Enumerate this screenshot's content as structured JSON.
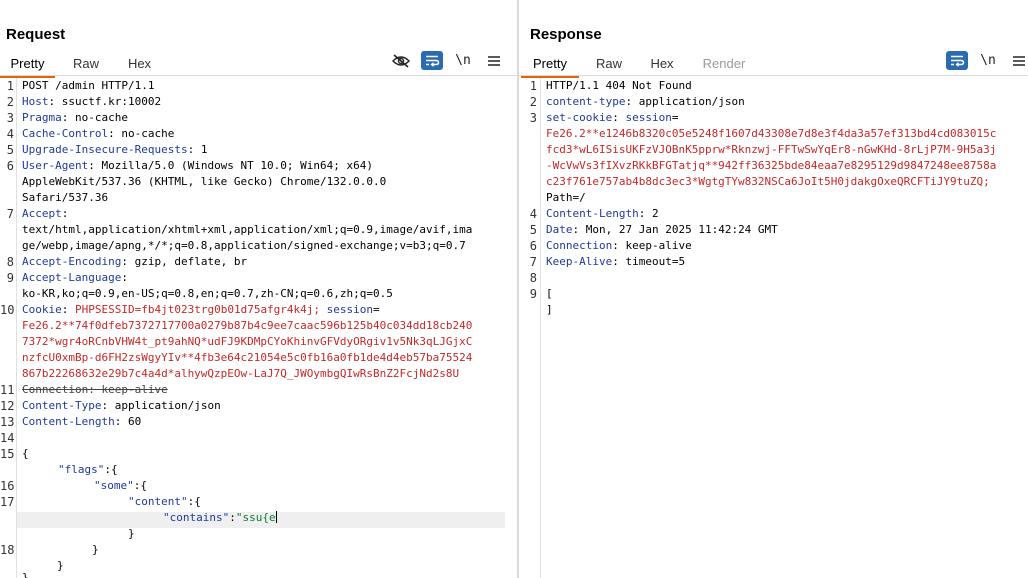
{
  "request": {
    "title": "Request",
    "tabs": [
      "Pretty",
      "Raw",
      "Hex"
    ],
    "newline_toggle": "\\n",
    "lines": {
      "l1": "POST /admin HTTP/1.1",
      "l2k": "Host",
      "l2v": ": ssuctf.kr:10002",
      "l3k": "Pragma",
      "l3v": ": no-cache",
      "l4k": "Cache-Control",
      "l4v": ": no-cache",
      "l5k": "Upgrade-Insecure-Requests",
      "l5v": ": 1",
      "l6k": "User-Agent",
      "l6v": ": Mozilla/5.0 (Windows NT 10.0; Win64; x64)",
      "l6c1": "AppleWebKit/537.36 (KHTML, like Gecko) Chrome/132.0.0.0",
      "l6c2": "Safari/537.36",
      "l7k": "Accept",
      "l7v": ":",
      "l7c1": "text/html,application/xhtml+xml,application/xml;q=0.9,image/avif,ima",
      "l7c2": "ge/webp,image/apng,*/*;q=0.8,application/signed-exchange;v=b3;q=0.7",
      "l8k": "Accept-Encoding",
      "l8v": ": gzip, deflate, br",
      "l9k": "Accept-Language",
      "l9v": ":",
      "l9c1": "ko-KR,ko;q=0.9,en-US;q=0.8,en;q=0.7,zh-CN;q=0.6,zh;q=0.5",
      "l10k": "Cookie",
      "l10colon": ":",
      "l10a": "PHPSESSID",
      "l10b": "=fb4jt023trg0b01d75afgr4k4j;",
      "l10c": "session",
      "l10d": "=",
      "l10c1": "Fe26.2**74f0dfeb7372717700a0279b87b4c9ee7caac596b125b40c034dd18cb240",
      "l10c2": "7372*wgr4oRCnbVHW4t_pt9ahNQ*udFJ9KDMpCYoKhinvGFVdyORgiv1v5Nk3qLJGjxC",
      "l10c3": "nzfcU0xmBp-d6FH2zsWgyYIv**4fb3e64c21054e5c0fb16a0fb1de4d4eb57ba75524",
      "l10c4": "867b22268632e29b7c4a4d*alhywQzpEOw-LaJ7Q_JWOymbgQIwRsBnZ2FcjNd2s8U",
      "l11": "Connection: keep-alive",
      "l12k": "Content-Type",
      "l12v": ": application/json",
      "l13k": "Content-Length",
      "l13v": ": 60",
      "l15": "{",
      "l15b_key": "\"flags\"",
      "l15b_rest": ":{",
      "l16_key": "\"some\"",
      "l16_rest": ":{",
      "l17_key": "\"content\"",
      "l17_rest": ":{",
      "l17b_key": "\"contains\"",
      "l17b_colon": ":",
      "l17b_val": "\"ssu{e",
      "l17c": "}",
      "l18": "}",
      "l18b": "}",
      "l19": "}"
    }
  },
  "response": {
    "title": "Response",
    "tabs": [
      "Pretty",
      "Raw",
      "Hex",
      "Render"
    ],
    "newline_toggle": "\\n",
    "lines": {
      "l1": "HTTP/1.1 404 Not Found",
      "l2k": "content-type",
      "l2v": ": application/json",
      "l3k": "set-cookie",
      "l3colon": ":",
      "l3a": "session",
      "l3b": "=",
      "l3c1": "Fe26.2**e1246b8320c05e5248f1607d43308e7d8e3f4da3a57ef313bd4cd083015c",
      "l3c2": "fcd3*wL6ISisUKFzVJOBnK5pprw*Rknzwj-FFTwSwYqEr8-nGwKHd-8rLjP7M-9H5a3j",
      "l3c3": "-WcVwVs3fIXvzRKkBFGTatjq**942ff36325bde84eaa7e8295129d9847248ee8758a",
      "l3c4": "c23f761e757ab4b8dc3ec3*WgtgTYw832NSCa6JoIt5H0jdakgOxeQRCFTiJY9tuZQ;",
      "l3c5": "Path=/",
      "l4k": "Content-Length",
      "l4v": ": 2",
      "l5k": "Date",
      "l5v": ": Mon, 27 Jan 2025 11:42:24 GMT",
      "l6k": "Connection",
      "l6v": ": keep-alive",
      "l7k": "Keep-Alive",
      "l7v": ": timeout=5",
      "l9a": "[",
      "l9b": "]"
    }
  },
  "line_numbers": {
    "request": [
      "1",
      "2",
      "3",
      "4",
      "5",
      "6",
      "7",
      "8",
      "9",
      "10",
      "11",
      "12",
      "13",
      "14",
      "15",
      "16",
      "17",
      "18"
    ],
    "response": [
      "1",
      "2",
      "3",
      "4",
      "5",
      "6",
      "7",
      "8",
      "9"
    ]
  },
  "colors": {
    "accent": "#2b6cb0",
    "active_tab_underline": "#e8620c",
    "header_key": "#1f3a9a",
    "value_red": "#c62828"
  },
  "icons": {
    "hide_nonprint": "eye-off-icon",
    "wrap": "word-wrap-icon",
    "menu": "hamburger-menu-icon",
    "layout_side": "layout-side-by-side-icon",
    "layout_top": "layout-top-bottom-icon",
    "layout_tabs": "layout-tabs-icon"
  }
}
